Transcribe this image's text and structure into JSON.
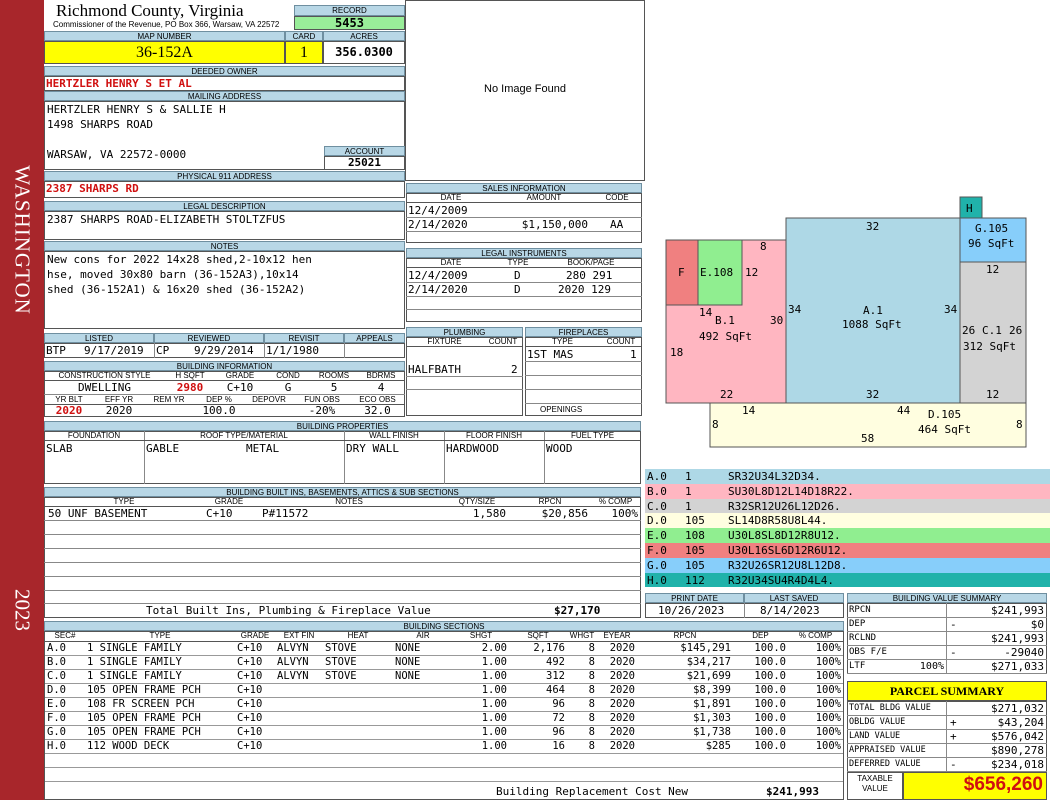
{
  "sidebar": {
    "district": "WASHINGTON",
    "year": "2023"
  },
  "header": {
    "county": "Richmond County, Virginia",
    "commissioner": "Commissioner of the Revenue, PO Box 366, Warsaw, VA 22572",
    "record_label": "RECORD",
    "record": "5453",
    "map_label": "MAP NUMBER",
    "map": "36-152A",
    "card_label": "CARD",
    "card": "1",
    "acres_label": "ACRES",
    "acres": "356.0300"
  },
  "owner": {
    "deeded_label": "DEEDED OWNER",
    "deeded": "HERTZLER HENRY S ET AL",
    "mailing_label": "MAILING ADDRESS",
    "mailing": [
      "HERTZLER HENRY S & SALLIE H",
      "1498 SHARPS ROAD",
      "WARSAW, VA 22572-0000"
    ],
    "account_label": "ACCOUNT",
    "account": "25021",
    "physical_label": "PHYSICAL 911 ADDRESS",
    "physical": "2387 SHARPS RD",
    "legal_label": "LEGAL DESCRIPTION",
    "legal": "2387 SHARPS ROAD-ELIZABETH STOLTZFUS",
    "notes_label": "NOTES",
    "notes": [
      "New cons for 2022 14x28 shed,2-10x12 hen",
      "hse, moved 30x80 barn (36-152A3),10x14",
      "shed (36-152A1) & 16x20 shed (36-152A2)"
    ]
  },
  "image": {
    "text": "No Image Found"
  },
  "sales": {
    "title": "SALES INFORMATION",
    "cols": [
      "DATE",
      "AMOUNT",
      "CODE"
    ],
    "rows": [
      [
        "12/4/2009",
        "",
        ""
      ],
      [
        "2/14/2020",
        "$1,150,000",
        "AA"
      ]
    ]
  },
  "legal_instruments": {
    "title": "LEGAL INSTRUMENTS",
    "cols": [
      "DATE",
      "TYPE",
      "BOOK/PAGE"
    ],
    "rows": [
      [
        "12/4/2009",
        "D",
        "280 291"
      ],
      [
        "2/14/2020",
        "D",
        "2020 129"
      ]
    ]
  },
  "plumbing": {
    "title": "PLUMBING",
    "cols": [
      "FIXTURE",
      "COUNT"
    ],
    "rows": [
      [
        "HALFBATH",
        "2"
      ]
    ]
  },
  "fireplaces": {
    "title": "FIREPLACES",
    "cols": [
      "TYPE",
      "COUNT"
    ],
    "rows": [
      [
        "1ST MAS",
        "1"
      ]
    ],
    "openings_label": "OPENINGS"
  },
  "review": {
    "cols": [
      "LISTED",
      "REVIEWED",
      "REVISIT",
      "APPEALS"
    ],
    "listed_by": "BTP",
    "listed": "9/17/2019",
    "reviewed_by": "CP",
    "reviewed": "9/29/2014",
    "revisit": "1/1/1980",
    "appeals": ""
  },
  "building_info": {
    "title": "BUILDING INFORMATION",
    "cols": [
      "CONSTRUCTION STYLE",
      "H SQFT",
      "GRADE",
      "COND",
      "ROOMS",
      "BDRMS"
    ],
    "vals": [
      "DWELLING",
      "2980",
      "C+10",
      "G",
      "5",
      "4"
    ],
    "cols2": [
      "YR BLT",
      "EFF YR",
      "REM YR",
      "DEP %",
      "DEPOVR",
      "FUN OBS",
      "ECO OBS"
    ],
    "vals2": [
      "2020",
      "2020",
      "",
      "100.0",
      "",
      "-20%",
      "32.0"
    ]
  },
  "building_props": {
    "title": "BUILDING PROPERTIES",
    "cols": [
      "FOUNDATION",
      "ROOF TYPE/MATERIAL",
      "WALL FINISH",
      "FLOOR FINISH",
      "FUEL TYPE"
    ],
    "vals": [
      "SLAB",
      "GABLE",
      "METAL",
      "DRY WALL",
      "HARDWOOD",
      "WOOD"
    ]
  },
  "built_ins": {
    "title": "BUILDING BUILT INS, BASEMENTS, ATTICS & SUB SECTIONS",
    "cols": [
      "TYPE",
      "GRADE",
      "NOTES",
      "QTY/SIZE",
      "RPCN",
      "% COMP"
    ],
    "rows": [
      [
        "50 UNF BASEMENT",
        "C+10",
        "P#11572",
        "1,580",
        "$20,856",
        "100%"
      ]
    ],
    "total_label": "Total Built Ins, Plumbing & Fireplace Value",
    "total": "$27,170"
  },
  "dates": {
    "print_label": "PRINT DATE",
    "print": "10/26/2023",
    "saved_label": "LAST SAVED",
    "saved": "8/14/2023"
  },
  "sketch_codes": [
    {
      "code": "A.0",
      "n": "1",
      "path": "SR32U34L32D34.",
      "color": "#aed8e6"
    },
    {
      "code": "B.0",
      "n": "1",
      "path": "SU30L8D12L14D18R22.",
      "color": "#ffb6c1"
    },
    {
      "code": "C.0",
      "n": "1",
      "path": "R32SR12U26L12D26.",
      "color": "#d3d3d3"
    },
    {
      "code": "D.0",
      "n": "105",
      "path": "SL14D8R58U8L44.",
      "color": "#fffee0"
    },
    {
      "code": "E.0",
      "n": "108",
      "path": "U30L8SL8D12R8U12.",
      "color": "#90ee90"
    },
    {
      "code": "F.0",
      "n": "105",
      "path": "U30L16SL6D12R6U12.",
      "color": "#f08080"
    },
    {
      "code": "G.0",
      "n": "105",
      "path": "R32U26SR12U8L12D8.",
      "color": "#87cefa"
    },
    {
      "code": "H.0",
      "n": "112",
      "path": "R32U34SU4R4D4L4.",
      "color": "#20b2aa"
    }
  ],
  "sketch": {
    "labels": {
      "A": "A.1",
      "A_area": "1088 SqFt",
      "B": "B.1",
      "B_area": "492 SqFt",
      "C": "C.1",
      "C_area": "312 SqFt",
      "D": "D.105",
      "D_area": "464 SqFt",
      "E": "E.108",
      "F": "F",
      "G": "G.105",
      "G_area": "96 SqFt",
      "H": "H"
    },
    "dims": [
      "32",
      "34",
      "34",
      "32",
      "8",
      "12",
      "14",
      "30",
      "18",
      "22",
      "26",
      "26",
      "12",
      "12",
      "14",
      "44",
      "8",
      "8",
      "58"
    ]
  },
  "sections": {
    "title": "BUILDING SECTIONS",
    "cols": [
      "SEC#",
      "TYPE",
      "GRADE",
      "EXT FIN",
      "HEAT",
      "AIR",
      "SHGT",
      "SQFT",
      "WHGT",
      "EYEAR",
      "RPCN",
      "DEP",
      "% COMP"
    ],
    "rows": [
      [
        "A.0",
        "1 SINGLE FAMILY",
        "C+10",
        "ALVYN",
        "STOVE",
        "NONE",
        "2.00",
        "2,176",
        "8",
        "2020",
        "$145,291",
        "100.0",
        "100%"
      ],
      [
        "B.0",
        "1 SINGLE FAMILY",
        "C+10",
        "ALVYN",
        "STOVE",
        "NONE",
        "1.00",
        "492",
        "8",
        "2020",
        "$34,217",
        "100.0",
        "100%"
      ],
      [
        "C.0",
        "1 SINGLE FAMILY",
        "C+10",
        "ALVYN",
        "STOVE",
        "NONE",
        "1.00",
        "312",
        "8",
        "2020",
        "$21,699",
        "100.0",
        "100%"
      ],
      [
        "D.0",
        "105 OPEN FRAME PCH",
        "C+10",
        "",
        "",
        "",
        "1.00",
        "464",
        "8",
        "2020",
        "$8,399",
        "100.0",
        "100%"
      ],
      [
        "E.0",
        "108 FR SCREEN PCH",
        "C+10",
        "",
        "",
        "",
        "1.00",
        "96",
        "8",
        "2020",
        "$1,891",
        "100.0",
        "100%"
      ],
      [
        "F.0",
        "105 OPEN FRAME PCH",
        "C+10",
        "",
        "",
        "",
        "1.00",
        "72",
        "8",
        "2020",
        "$1,303",
        "100.0",
        "100%"
      ],
      [
        "G.0",
        "105 OPEN FRAME PCH",
        "C+10",
        "",
        "",
        "",
        "1.00",
        "96",
        "8",
        "2020",
        "$1,738",
        "100.0",
        "100%"
      ],
      [
        "H.0",
        "112 WOOD DECK",
        "C+10",
        "",
        "",
        "",
        "1.00",
        "16",
        "8",
        "2020",
        "$285",
        "100.0",
        "100%"
      ]
    ],
    "total_label": "Building Replacement Cost New",
    "total": "$241,993"
  },
  "bv_summary": {
    "title": "BUILDING VALUE SUMMARY",
    "rows": [
      [
        "RPCN",
        "",
        "",
        "$241,993"
      ],
      [
        "DEP",
        "",
        "-",
        "$0"
      ],
      [
        "RCLND",
        "",
        "",
        "$241,993"
      ],
      [
        "OBS F/E",
        "",
        "-",
        "-29040"
      ],
      [
        "LTF",
        "100%",
        "",
        "$271,033"
      ]
    ]
  },
  "parcel": {
    "title": "PARCEL SUMMARY",
    "rows": [
      [
        "TOTAL BLDG VALUE",
        "",
        "$271,032"
      ],
      [
        "OBLDG VALUE",
        "+",
        "$43,204"
      ],
      [
        "LAND VALUE",
        "+",
        "$576,042"
      ],
      [
        "APPRAISED VALUE",
        "",
        "$890,278"
      ],
      [
        "DEFERRED VALUE",
        "-",
        "$234,018"
      ]
    ],
    "taxable_label1": "TAXABLE",
    "taxable_label2": "VALUE",
    "taxable": "$656,260"
  },
  "colors": {
    "sidebar": "#a8262b",
    "header": "#b8d7e6",
    "yellow": "#ffff00",
    "green": "#99ee99",
    "red_text": "#d01010"
  }
}
